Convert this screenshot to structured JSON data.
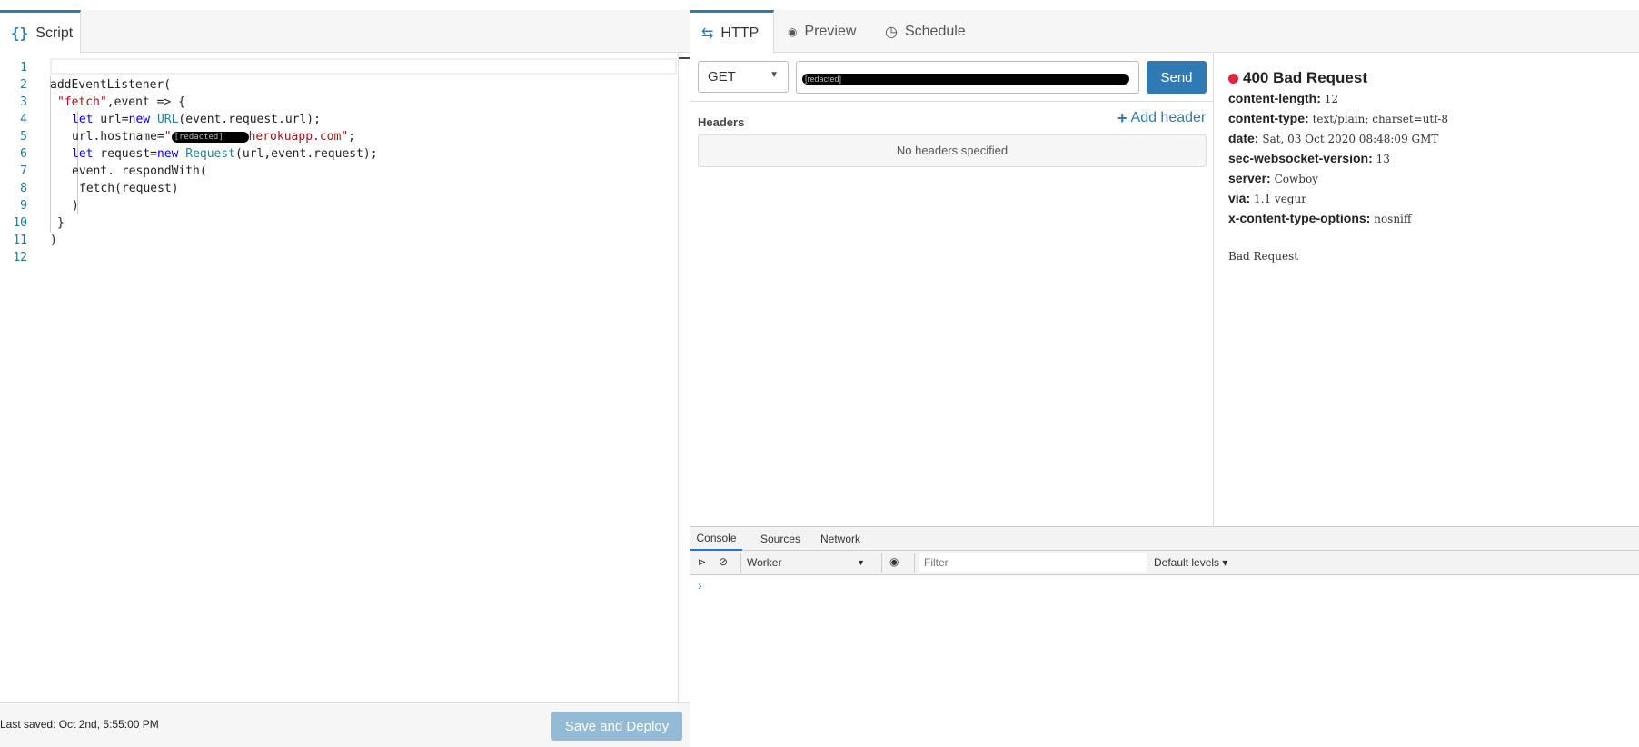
{
  "script_tab": {
    "icon": "braces-icon",
    "label": "Script"
  },
  "code_lines": [
    {
      "n": "1",
      "t": ""
    },
    {
      "n": "2",
      "t": "addEventListener("
    },
    {
      "n": "3",
      "t": "\"fetch\",event => {"
    },
    {
      "n": "4",
      "t": "let url=new URL(event.request.url);"
    },
    {
      "n": "5",
      "t": "url.hostname=\"[redacted]herokuapp.com\";"
    },
    {
      "n": "6",
      "t": "let request=new Request(url,event.request);"
    },
    {
      "n": "7",
      "t": "event. respondWith("
    },
    {
      "n": "8",
      "t": "fetch(request)"
    },
    {
      "n": "9",
      "t": ")"
    },
    {
      "n": "10",
      "t": "}"
    },
    {
      "n": "11",
      "t": ")"
    },
    {
      "n": "12",
      "t": ""
    }
  ],
  "footer": {
    "last_saved": "Last saved: Oct 2nd, 5:55:00 PM",
    "deploy_label": "Save and Deploy"
  },
  "right_tabs": [
    {
      "label": "HTTP",
      "icon": "arrows-exchange-icon"
    },
    {
      "label": "Preview",
      "icon": "eye-icon"
    },
    {
      "label": "Schedule",
      "icon": "clock-icon"
    }
  ],
  "request": {
    "method": "GET",
    "url": "[redacted]",
    "send_label": "Send",
    "headers_title": "Headers",
    "add_header_label": "Add header",
    "no_headers": "No headers specified"
  },
  "response": {
    "status": "400 Bad Request",
    "status_color": "#e0263c",
    "headers": [
      {
        "k": "content-length:",
        "v": "12"
      },
      {
        "k": "content-type:",
        "v": "text/plain; charset=utf-8"
      },
      {
        "k": "date:",
        "v": "Sat, 03 Oct 2020 08:48:09 GMT"
      },
      {
        "k": "sec-websocket-version:",
        "v": "13"
      },
      {
        "k": "server:",
        "v": "Cowboy"
      },
      {
        "k": "via:",
        "v": "1.1 vegur"
      },
      {
        "k": "x-content-type-options:",
        "v": "nosniff"
      }
    ],
    "body": "Bad Request"
  },
  "devtools": {
    "tabs": [
      "Console",
      "Sources",
      "Network"
    ],
    "context": "Worker",
    "filter_placeholder": "Filter",
    "levels": "Default levels ▾",
    "prompt": "›"
  },
  "colors": {
    "accent": "#2f7ab5",
    "deploy_disabled": "#93bbd6"
  }
}
